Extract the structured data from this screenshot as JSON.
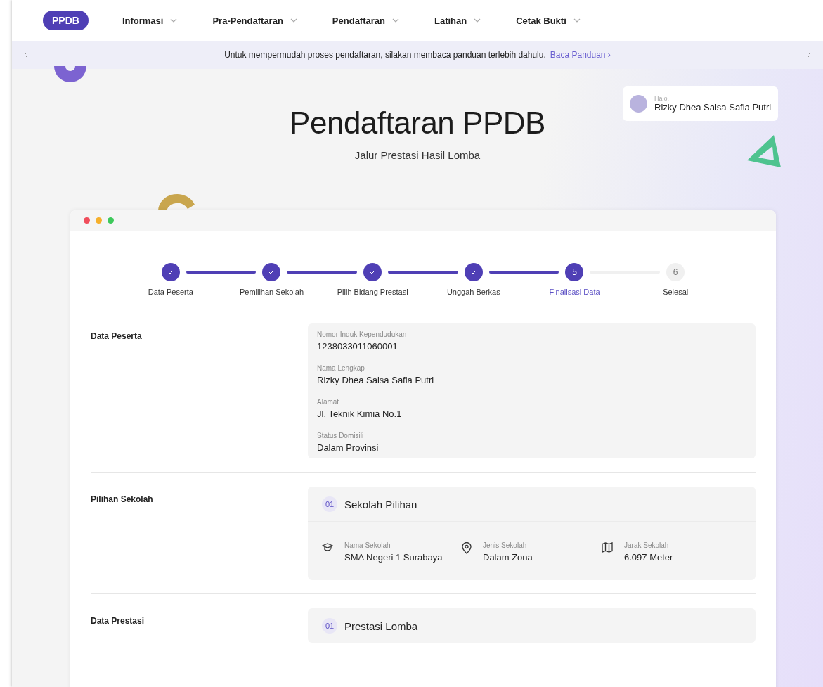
{
  "nav": {
    "brand": "PPDB",
    "items": [
      {
        "label": "Informasi"
      },
      {
        "label": "Pra-Pendaftaran"
      },
      {
        "label": "Pendaftaran"
      },
      {
        "label": "Latihan"
      },
      {
        "label": "Cetak Bukti"
      }
    ]
  },
  "banner": {
    "text": "Untuk mempermudah proses pendaftaran, silakan membaca panduan terlebih dahulu.",
    "link": "Baca Panduan ›"
  },
  "greeting": {
    "salutation": "Halo,",
    "name": "Rizky Dhea Salsa Safia Putri"
  },
  "hero": {
    "title": "Pendaftaran PPDB",
    "subtitle": "Jalur Prestasi Hasil Lomba"
  },
  "steps": [
    {
      "label": "Data Peserta",
      "kind": "done"
    },
    {
      "label": "Pemilihan Sekolah",
      "kind": "done"
    },
    {
      "label": "Pilih Bidang Prestasi",
      "kind": "done"
    },
    {
      "label": "Unggah Berkas",
      "kind": "done"
    },
    {
      "label": "Finalisasi Data",
      "kind": "current",
      "number": "5"
    },
    {
      "label": "Selesai",
      "kind": "todo",
      "number": "6"
    }
  ],
  "sections": [
    {
      "kind": "fields",
      "label": "Data Peserta",
      "fields": [
        {
          "label": "Nomor Induk Kependudukan",
          "value": "1238033011060001"
        },
        {
          "label": "Nama Lengkap",
          "value": "Rizky Dhea Salsa Safia Putri"
        },
        {
          "label": "Alamat",
          "value": "Jl. Teknik Kimia No.1"
        },
        {
          "label": "Status Domisili",
          "value": "Dalam Provinsi"
        }
      ]
    },
    {
      "kind": "items",
      "label": "Pilihan Sekolah",
      "items": [
        {
          "number": "01",
          "title": "Sekolah Pilihan",
          "details": [
            {
              "label": "Nama Sekolah",
              "value": "SMA Negeri 1 Surabaya"
            },
            {
              "label": "Jenis Sekolah",
              "value": "Dalam Zona"
            },
            {
              "label": "Jarak Sekolah",
              "value": "6.097 Meter"
            }
          ]
        }
      ]
    },
    {
      "kind": "items",
      "label": "Data Prestasi",
      "items": [
        {
          "number": "01",
          "title": "Prestasi Lomba"
        }
      ]
    }
  ]
}
